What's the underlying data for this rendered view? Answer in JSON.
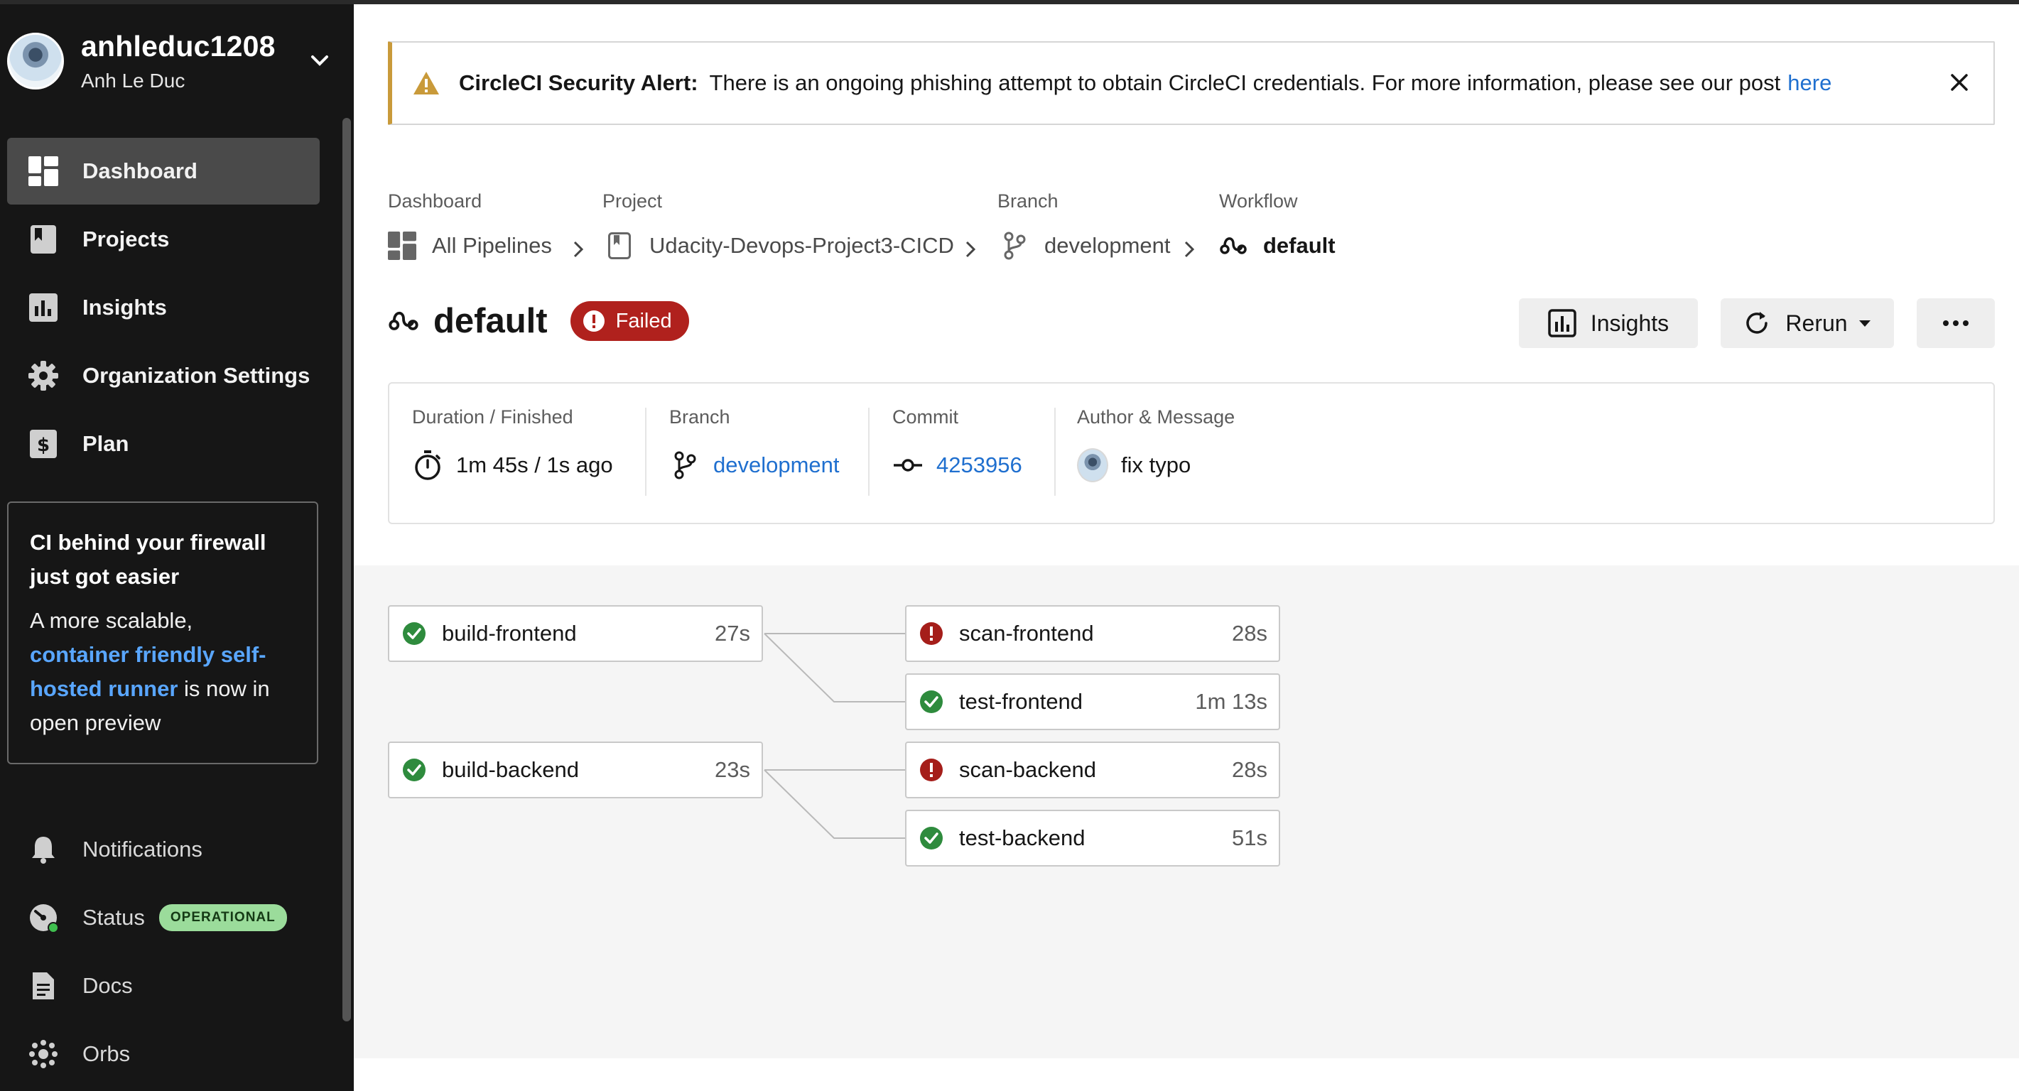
{
  "user": {
    "username": "anhleduc1208",
    "display_name": "Anh Le Duc"
  },
  "sidebar": {
    "items": [
      {
        "label": "Dashboard",
        "icon": "dashboard-icon",
        "active": true
      },
      {
        "label": "Projects",
        "icon": "book-icon"
      },
      {
        "label": "Insights",
        "icon": "chart-icon"
      },
      {
        "label": "Organization Settings",
        "icon": "gear-icon"
      },
      {
        "label": "Plan",
        "icon": "dollar-icon"
      }
    ],
    "promo": {
      "title": "CI behind your firewall just got easier",
      "text_before": "A more scalable,",
      "link": "container friendly self-hosted runner",
      "text_after": "is now in open preview"
    },
    "bottom_items": [
      {
        "label": "Notifications",
        "icon": "bell-icon"
      },
      {
        "label": "Status",
        "icon": "status-gauge-icon",
        "badge": "OPERATIONAL"
      },
      {
        "label": "Docs",
        "icon": "document-icon"
      },
      {
        "label": "Orbs",
        "icon": "orbs-icon"
      }
    ]
  },
  "alert": {
    "title": "CircleCI Security Alert:",
    "message": "There is an ongoing phishing attempt to obtain CircleCI credentials. For more information, please see our post",
    "link": "here",
    "color": "#c99a3a"
  },
  "breadcrumb": {
    "labels": [
      "Dashboard",
      "Project",
      "Branch",
      "Workflow"
    ],
    "values": [
      "All Pipelines",
      "Udacity-Devops-Project3-CICD",
      "development",
      "default"
    ]
  },
  "workflow": {
    "name": "default",
    "status": "Failed",
    "status_color": "#b0211d",
    "buttons": {
      "insights": "Insights",
      "rerun": "Rerun",
      "more": "more-options"
    }
  },
  "meta": {
    "duration_label": "Duration / Finished",
    "duration_value": "1m 45s / 1s ago",
    "branch_label": "Branch",
    "branch_value": "development",
    "commit_label": "Commit",
    "commit_value": "4253956",
    "author_label": "Author & Message",
    "message": "fix typo"
  },
  "jobs": [
    {
      "name": "build-frontend",
      "duration": "27s",
      "status": "success"
    },
    {
      "name": "scan-frontend",
      "duration": "28s",
      "status": "failed"
    },
    {
      "name": "test-frontend",
      "duration": "1m 13s",
      "status": "success"
    },
    {
      "name": "build-backend",
      "duration": "23s",
      "status": "success"
    },
    {
      "name": "scan-backend",
      "duration": "28s",
      "status": "failed"
    },
    {
      "name": "test-backend",
      "duration": "51s",
      "status": "success"
    }
  ],
  "colors": {
    "success": "#2e8b3d",
    "failed": "#a51e1a",
    "link": "#1f6fcf",
    "sidebar_bg": "#161616"
  }
}
